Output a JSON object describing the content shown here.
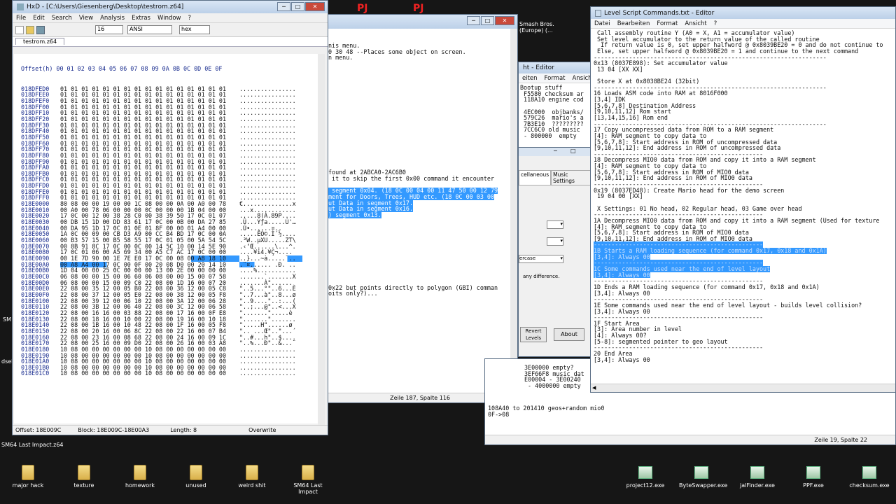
{
  "desktop": {
    "top_labels": [
      "PJ",
      "PJ"
    ],
    "smash_label": "Smash Bros.\n(Europe) (...",
    "left_labels": [
      "SM",
      "dsel"
    ],
    "loose_label": "SM64 Last Impact.z64",
    "folders": [
      "major hack",
      "texture",
      "homework",
      "unused",
      "weird shit",
      "SM64 Last Impact"
    ],
    "exes": [
      "project12.exe",
      "ByteSwapper.exe",
      "jalFinder.exe",
      "PPF.exe",
      "checksum.exe"
    ]
  },
  "hxd": {
    "title": "HxD - [C:\\Users\\Giesenberg\\Desktop\\testrom.z64]",
    "menu": [
      "File",
      "Edit",
      "Search",
      "View",
      "Analysis",
      "Extras",
      "Window",
      "?"
    ],
    "toolbar": {
      "columns": "16",
      "charset": "ANSI",
      "base": "hex"
    },
    "tab": "testrom.z64",
    "header": "Offset(h) 00 01 02 03 04 05 06 07 08 09 0A 0B 0C 0D 0E 0F",
    "rows": [
      [
        "018DFED0",
        "01 01 01 01 01 01 01 01 01 01 01 01 01 01 01 01",
        "................"
      ],
      [
        "018DFEE0",
        "01 01 01 01 01 01 01 01 01 01 01 01 01 01 01 01",
        "................"
      ],
      [
        "018DFEF0",
        "01 01 01 01 01 01 01 01 01 01 01 01 01 01 01 01",
        "................"
      ],
      [
        "018DFF00",
        "01 01 01 01 01 01 01 01 01 01 01 01 01 01 01 01",
        "................"
      ],
      [
        "018DFF10",
        "01 01 01 01 01 01 01 01 01 01 01 01 01 01 01 01",
        "................"
      ],
      [
        "018DFF20",
        "01 01 01 01 01 01 01 01 01 01 01 01 01 01 01 01",
        "................"
      ],
      [
        "018DFF30",
        "01 01 01 01 01 01 01 01 01 01 01 01 01 01 01 01",
        "................"
      ],
      [
        "018DFF40",
        "01 01 01 01 01 01 01 01 01 01 01 01 01 01 01 01",
        "................"
      ],
      [
        "018DFF50",
        "01 01 01 01 01 01 01 01 01 01 01 01 01 01 01 01",
        "................"
      ],
      [
        "018DFF60",
        "01 01 01 01 01 01 01 01 01 01 01 01 01 01 01 01",
        "................"
      ],
      [
        "018DFF70",
        "01 01 01 01 01 01 01 01 01 01 01 01 01 01 01 01",
        "................"
      ],
      [
        "018DFF80",
        "01 01 01 01 01 01 01 01 01 01 01 01 01 01 01 01",
        "................"
      ],
      [
        "018DFF90",
        "01 01 01 01 01 01 01 01 01 01 01 01 01 01 01 01",
        "................"
      ],
      [
        "018DFFA0",
        "01 01 01 01 01 01 01 01 01 01 01 01 01 01 01 01",
        "................"
      ],
      [
        "018DFFB0",
        "01 01 01 01 01 01 01 01 01 01 01 01 01 01 01 01",
        "................"
      ],
      [
        "018DFFC0",
        "01 01 01 01 01 01 01 01 01 01 01 01 01 01 01 01",
        "................"
      ],
      [
        "018DFFD0",
        "01 01 01 01 01 01 01 01 01 01 01 01 01 01 01 01",
        "................"
      ],
      [
        "018DFFE0",
        "01 01 01 01 01 01 01 01 01 01 01 01 01 01 01 01",
        "................"
      ],
      [
        "018DFFF0",
        "01 01 01 01 01 01 01 01 01 01 01 01 01 01 01 01",
        "................"
      ],
      [
        "018E0000",
        "80 08 00 00 19 00 00 1C 08 00 00 0A 00 A0 00 78",
        "€..............x"
      ],
      [
        "018E0010",
        "00 A0 00 78 06 00 00 00 0C 00 00 00 1B 04 00 00",
        "...x............"
      ],
      [
        "018E0020",
        "17 0C 00 12 00 38 28 C0 00 38 39 50 17 0C 01 07",
        ".....8(À.89P...."
      ],
      [
        "018E0030",
        "00 DB 15 1D 00 DD 83 61 17 0C 00 0B 00 DA 27 85",
        ".Û...Ýƒa.....Ú'…"
      ],
      [
        "018E0040",
        "00 DA 95 1D 17 0C 01 0E 01 8F 00 00 01 A4 00 00",
        ".Ú•......¤.."
      ],
      [
        "018E0050",
        "1A 0C 00 09 00 CB D3 A9 00 CC B4 BD 17 0C 00 0A",
        ".....ËÓ©.Ì´½...."
      ],
      [
        "018E0060",
        "00 B3 57 15 00 B5 58 55 17 0C 01 05 00 5A 54 5C",
        ".³W..µXU.....ZT\\"
      ],
      [
        "018E0070",
        "00 8B 91 8C 17 0C 00 0C 00 14 5C 10 00 14 5E 90",
        ".‹‘Œ......\\...^."
      ],
      [
        "018E0080",
        "17 0C 01 06 00 A5 69 34 00 A5 C7 AC 17 0C 00 00",
        "....¥i4.¥Ç¬...."
      ],
      [
        "018E0090",
        "00 1E 7D 90 00 1E 7E E0 17 0C 00 08 00 A8 18 10",
        "..}...~à.....¨.."
      ],
      [
        "018E00A0",
        "00 A8 A4 00 17 0C 00 0F 00 20 08 D0 00 20 14 10",
        ".¨¤...... .Ð. .."
      ],
      [
        "018E00B0",
        "1D 04 00 00 25 0C 00 00 00 13 00 2E 00 00 00 00",
        "....%..........."
      ],
      [
        "018E00C0",
        "06 08 00 00 15 00 06 60 06 08 00 00 15 00 07 58",
        ".......`.......X"
      ],
      [
        "018E00D0",
        "06 08 00 00 15 00 09 C0 22 08 00 1D 16 00 07 20",
        ".......À\"...... "
      ],
      [
        "018E00E0",
        "22 08 00 35 12 00 05 B0 22 08 00 36 12 00 05 C8",
        "\"..5...°\"..6...È"
      ],
      [
        "018E00F0",
        "22 08 00 37 12 00 05 E0 22 08 00 38 12 00 05 F8",
        "\"..7...à\"..8...ø"
      ],
      [
        "018E0100",
        "22 08 00 39 12 00 06 10 22 08 00 3A 12 00 06 28",
        "\"..9....\"..:...("
      ],
      [
        "018E0110",
        "22 08 00 3B 12 00 06 40 22 08 00 3C 12 00 06 58",
        "\"..;...@\"..<...X"
      ],
      [
        "018E0120",
        "22 08 00 16 16 00 03 88 22 08 00 17 16 00 0F E8",
        "\".......\".....è"
      ],
      [
        "018E0130",
        "22 08 00 18 16 00 10 00 22 08 00 19 16 00 10 18",
        "\".......\"......."
      ],
      [
        "018E0140",
        "22 08 00 1B 16 00 10 48 22 08 00 1F 16 00 05 F8",
        "\".....H\"......ø"
      ],
      [
        "018E0150",
        "22 08 00 20 16 00 06 8C 22 08 00 22 16 00 07 B4",
        "\".. ...Œ\"..\"...´"
      ],
      [
        "018E0160",
        "22 08 00 23 16 00 08 68 22 08 00 24 16 00 09 1C",
        "\"..#...h\"..$...."
      ],
      [
        "018E0170",
        "22 08 00 25 16 00 09 D0 22 08 00 26 16 00 03 A8",
        "\"..%...Ð\"..&...¨"
      ],
      [
        "018E0180",
        "10 08 00 00 00 00 00 00 10 08 00 00 00 00 00 00",
        "................"
      ],
      [
        "018E0190",
        "10 08 00 00 00 00 00 00 10 08 00 00 00 00 00 00",
        "................"
      ],
      [
        "018E01A0",
        "10 08 00 00 00 00 00 00 10 08 00 00 00 00 00 00",
        "................"
      ],
      [
        "018E01B0",
        "10 08 00 00 00 00 00 00 10 08 00 00 00 00 00 00",
        "................"
      ],
      [
        "018E01C0",
        "10 08 00 00 00 00 00 00 10 08 00 00 00 00 00 00",
        "................"
      ]
    ],
    "status": {
      "offset": "Offset: 18E009C",
      "block": "Block: 18E009C-18E00A3",
      "length": "Length: 8",
      "mode": "Overwrite"
    }
  },
  "notepad_mid": {
    "lines": [
      "nis menu.",
      "0 30 48 --Places some object on screen.",
      "n menu.",
      "",
      "",
      "",
      "",
      "",
      "",
      "",
      "",
      "",
      "",
      "",
      "",
      "",
      "",
      "",
      "",
      "",
      "",
      "found at 2ABCA0-2AC6B0",
      " it to skip the first 0x00 command it encounter",
      ""
    ],
    "hl_lines": [
      " segment 0x04. (18 0C 00 04 00 11 47 50 00 12 79",
      "ment for Doors, Trees, HUD etc. (18 0C 00 03 00",
      "ut Data in segment 0x17.",
      "ut Data in segment 0x16.",
      ") segment 0x13."
    ],
    "lines2": [
      "0x22 but points directly to polygon (GBI) comman",
      "oits only?)..."
    ],
    "status": "Zeile 187, Spalte 116"
  },
  "editor_small": {
    "title": "ht - Editor",
    "menu": [
      "eiten",
      "Format",
      "Ansicht"
    ],
    "lines": [
      "Bootup stuff",
      " F5580 checksum ar",
      " 118A10 engine cod",
      "",
      " 4EC000  objbanks/",
      " 579C26  mario's a",
      " 7B3E10  ?????????",
      " 7CC6C0 old music",
      " - 800000  empty"
    ]
  },
  "tool": {
    "tabs": [
      "cellaneous",
      "Music Settings"
    ],
    "select": "ercase",
    "note": "any difference.",
    "revert": "Revert\nLevels",
    "about": "About"
  },
  "bottom_editor": {
    "lines": [
      "3E00000 empty?",
      "3EF66F8 music dat",
      "E00004 - 3E00240",
      " - 4000000 empty",
      "",
      "108A40 to 201410 geos+random mio0",
      "0F->08"
    ],
    "status": "Zeile 19, Spalte 22"
  },
  "script": {
    "title": "Level Script Commands.txt - Editor",
    "menu": [
      "Datei",
      "Bearbeiten",
      "Format",
      "Ansicht",
      "?"
    ],
    "lines": [
      {
        "t": " Call assembly routine Y (A0 = X, A1 = accumulator value)"
      },
      {
        "t": " Set level accumulator to the return value of the called routine"
      },
      {
        "t": "  If return value is 0, set upper halfword @ 0x8039BE20 = 0 and do not continue to"
      },
      {
        "t": " Else, set upper halfword @ 0x8039BE20 = 1 and continue to the next command"
      },
      {
        "t": "------------------------------------------------------------------"
      },
      {
        "t": "0x13 (8037E898): Set accumulator value"
      },
      {
        "t": " 13 04 [XX XX]"
      },
      {
        "t": ""
      },
      {
        "t": " Store X at 0x8038BE24 (32bit)"
      },
      {
        "t": "------------------------------------------------------------------"
      },
      {
        "t": "16 Loads ASM code into RAM at 8016F000"
      },
      {
        "t": "[3,4] IDK"
      },
      {
        "t": "[5,6,7,8] Destination Address"
      },
      {
        "t": "[9,10,11,12] Rom start"
      },
      {
        "t": "[13,14,15,16] Rom end"
      },
      {
        "t": "------------------------------------------------------------------"
      },
      {
        "t": "17 Copy uncompressed data from ROM to a RAM segment"
      },
      {
        "t": "[4]: RAM segment to copy data to"
      },
      {
        "t": "[5,6,7,8]: Start address in ROM of uncompressed data"
      },
      {
        "t": "[9,10,11,12]: End address in ROM of uncompressed data"
      },
      {
        "t": "------------------------------------------------"
      },
      {
        "t": "18 Decompress MIO0 data from ROM and copy it into a RAM segment"
      },
      {
        "t": "[4]: RAM segment to copy data to"
      },
      {
        "t": "[5,6,7,8]: Start address in ROM of MIO0 data"
      },
      {
        "t": "[9,10,11,12]: End address in ROM of MIO0 data"
      },
      {
        "t": "------------------------------------------------"
      },
      {
        "t": "0x19 (8037ED48): Create Mario head for the demo screen"
      },
      {
        "t": " 19 04 00 [XX]"
      },
      {
        "t": ""
      },
      {
        "t": " X Settings: 01 No head, 02 Regular head, 03 Game over head"
      },
      {
        "t": "------------------------------------------------"
      },
      {
        "t": "1A Decompress MIO0 data from ROM and copy it into a RAM segment (Used for texture"
      },
      {
        "t": "[4]: RAM segment to copy data to"
      },
      {
        "t": "[5,6,7,8]: Start address in ROM of MIO0 data"
      },
      {
        "t": "[9,10,11,12]: End address in ROM of MIO0 data"
      },
      {
        "t": "------------------------------------------------",
        "h": true
      },
      {
        "t": "1B Starts a RAM loading sequence (for command 0x17, 0x18 and 0x1A)",
        "h": true
      },
      {
        "t": "[3,4]: Always 00",
        "h": true
      },
      {
        "t": "------------------------------------------------",
        "h": true
      },
      {
        "t": "1C Some commands used near the end of level layout",
        "h": true
      },
      {
        "t": "[3,4]: Always 00",
        "h": true
      },
      {
        "t": "------------------------------------------------"
      },
      {
        "t": "1D Ends a RAM loading sequence (for command 0x17, 0x18 and 0x1A)"
      },
      {
        "t": "[3,4]: Always 00"
      },
      {
        "t": "------------------------------------------------"
      },
      {
        "t": "1E Some commands used near the end of level layout - builds level collision?"
      },
      {
        "t": "[3,4]: Always 00"
      },
      {
        "t": "------------------------------------------------"
      },
      {
        "t": "1F Start Area"
      },
      {
        "t": "[3]: Area number in level"
      },
      {
        "t": "[4]: Always 00?"
      },
      {
        "t": "[5-8]: segmented pointer to geo layout"
      },
      {
        "t": "------------------------------------------------"
      },
      {
        "t": "20 End Area"
      },
      {
        "t": "[3,4]: Always 00"
      }
    ]
  },
  "colors": {
    "selection": "#3399ff",
    "desktop": "#161616"
  }
}
